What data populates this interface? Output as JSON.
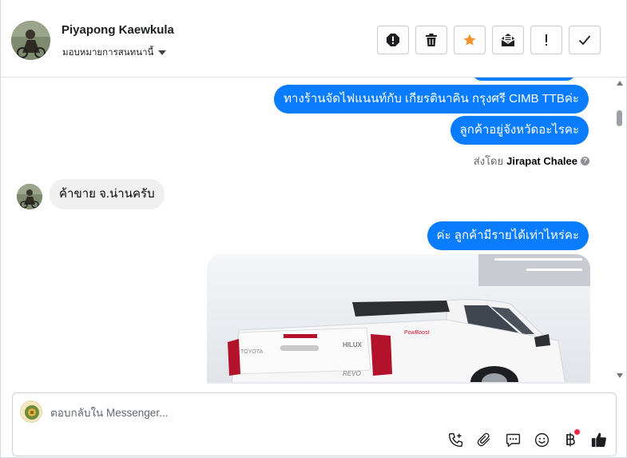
{
  "header": {
    "contact_name": "Piyapong Kaewkula",
    "assign_label": "มอบหมายการสนทนานี้",
    "actions": [
      {
        "name": "spam-icon",
        "label": "Mark as spam"
      },
      {
        "name": "trash-icon",
        "label": "Delete"
      },
      {
        "name": "star-icon",
        "label": "Star"
      },
      {
        "name": "mark-unread-icon",
        "label": "Mark as unread"
      },
      {
        "name": "follow-up-icon",
        "label": "Follow up"
      },
      {
        "name": "check-icon",
        "label": "Mark as done"
      }
    ],
    "star_color": "#f5922a"
  },
  "messages": {
    "outgoing_1": "ทางร้านจัดไฟแนนท์กับ เกียรตินาคิน กรุงศรี CIMB TTBค่ะ",
    "outgoing_2": "ลูกค้าอยู่จังหวัดอะไรคะ",
    "sent_by_prefix": "ส่งโดย",
    "sent_by_name": "Jirapat Chalee",
    "help_glyph": "?",
    "incoming_1": "ค้าขาย จ.น่านครับ",
    "outgoing_3": "ค่ะ ลูกค้ามีรายได้เท่าไหร่คะ",
    "photo_description": "white Toyota Hilux Revo pickup truck"
  },
  "composer": {
    "placeholder": "ตอบกลับใน Messenger...",
    "tools": [
      "call-add-icon",
      "attachment-icon",
      "saved-replies-icon",
      "emoji-icon",
      "baht-payment-icon",
      "like-icon"
    ]
  },
  "colors": {
    "outgoing_bubble": "#0a7cff",
    "incoming_bubble": "#f0f0f0",
    "notification_dot": "#f02849"
  }
}
